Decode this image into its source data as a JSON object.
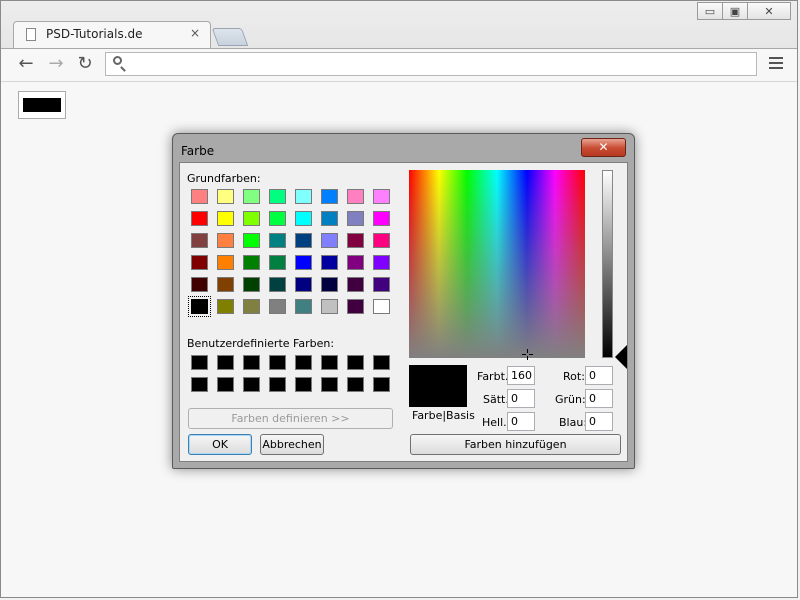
{
  "browser": {
    "tab_title": "PSD-Tutorials.de",
    "tab_close": "×",
    "address_value": "",
    "win_minimize": "▭",
    "win_maximize": "▣",
    "win_close": "✕"
  },
  "page": {
    "swatch_color": "#000000"
  },
  "dialog": {
    "title": "Farbe",
    "close_symbol": "✕",
    "basic_colors_label": "Grundfarben:",
    "basic_colors": [
      [
        "#ff8080",
        "#ffff80",
        "#80ff80",
        "#00ff80",
        "#80ffff",
        "#0080ff",
        "#ff80c0",
        "#ff80ff"
      ],
      [
        "#ff0000",
        "#ffff00",
        "#80ff00",
        "#00ff40",
        "#00ffff",
        "#0080c0",
        "#8080c0",
        "#ff00ff"
      ],
      [
        "#804040",
        "#ff8040",
        "#00ff00",
        "#008080",
        "#004080",
        "#8080ff",
        "#800040",
        "#ff0080"
      ],
      [
        "#800000",
        "#ff8000",
        "#008000",
        "#008040",
        "#0000ff",
        "#0000a0",
        "#800080",
        "#8000ff"
      ],
      [
        "#400000",
        "#804000",
        "#004000",
        "#004040",
        "#000080",
        "#000040",
        "#400040",
        "#400080"
      ],
      [
        "#000000",
        "#808000",
        "#808040",
        "#808080",
        "#408080",
        "#c0c0c0",
        "#400040",
        "#ffffff"
      ]
    ],
    "selected_basic": "#000000",
    "custom_colors_label": "Benutzerdefinierte Farben:",
    "custom_colors": [
      [
        "#000000",
        "#000000",
        "#000000",
        "#000000",
        "#000000",
        "#000000",
        "#000000",
        "#000000"
      ],
      [
        "#000000",
        "#000000",
        "#000000",
        "#000000",
        "#000000",
        "#000000",
        "#000000",
        "#000000"
      ]
    ],
    "define_button": "Farben definieren >>",
    "ok_button": "OK",
    "cancel_button": "Abbrechen",
    "preview_label": "Farbe|Basis",
    "preview_color": "#000000",
    "hue_label": "Farbt.:",
    "hue_value": "160",
    "sat_label": "Sätt.:",
    "sat_value": "0",
    "lum_label": "Hell.:",
    "lum_value": "0",
    "red_label": "Rot:",
    "red_value": "0",
    "green_label": "Grün:",
    "green_value": "0",
    "blue_label": "Blau:",
    "blue_value": "0",
    "add_button": "Farben hinzufügen"
  }
}
